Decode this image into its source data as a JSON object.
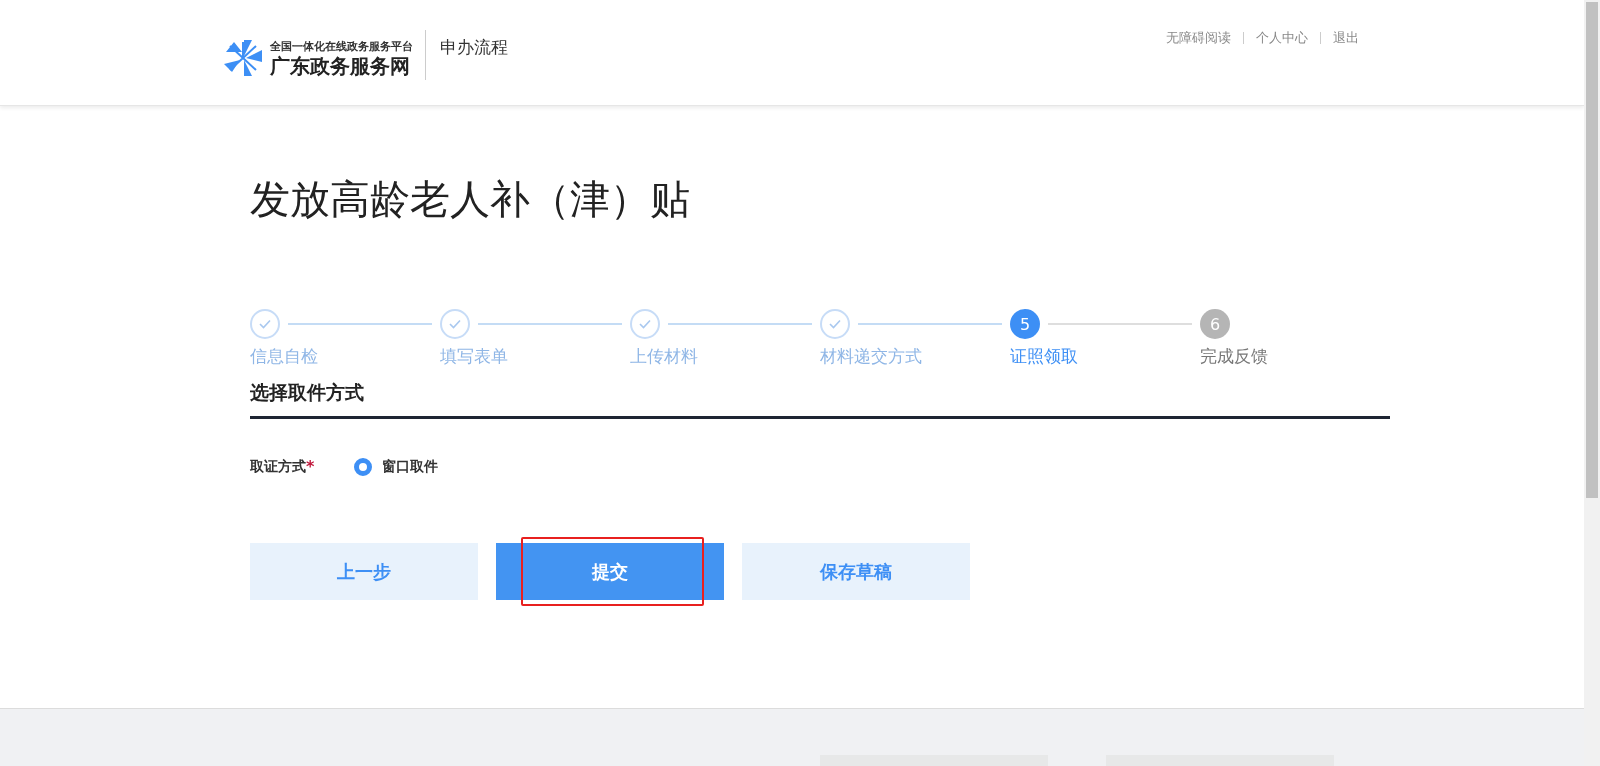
{
  "header": {
    "logo_tagline": "全国一体化在线政务服务平台",
    "logo_name": "广东政务服务网",
    "section": "申办流程",
    "links": [
      "无障碍阅读",
      "个人中心",
      "退出"
    ]
  },
  "title": "发放高龄老人补（津）贴",
  "steps": [
    {
      "label": "信息自检",
      "completed": true,
      "selected": false
    },
    {
      "label": "填写表单",
      "completed": true,
      "selected": false
    },
    {
      "label": "上传材料",
      "completed": true,
      "selected": false
    },
    {
      "label": "材料递交方式",
      "completed": true,
      "selected": false
    },
    {
      "number": "5",
      "label": "证照领取",
      "completed": false,
      "selected": true
    },
    {
      "number": "6",
      "label": "完成反馈",
      "completed": false,
      "selected": false
    }
  ],
  "section_title": "选择取件方式",
  "field": {
    "label": "取证方式",
    "required_mark": "*",
    "options": [
      {
        "label": "窗口取件",
        "selected": true
      }
    ]
  },
  "buttons": [
    {
      "label": "上一步",
      "kind": "secondary",
      "highlighted": false
    },
    {
      "label": "提交",
      "kind": "primary",
      "highlighted": true
    },
    {
      "label": "保存草稿",
      "kind": "secondary",
      "highlighted": false
    }
  ]
}
